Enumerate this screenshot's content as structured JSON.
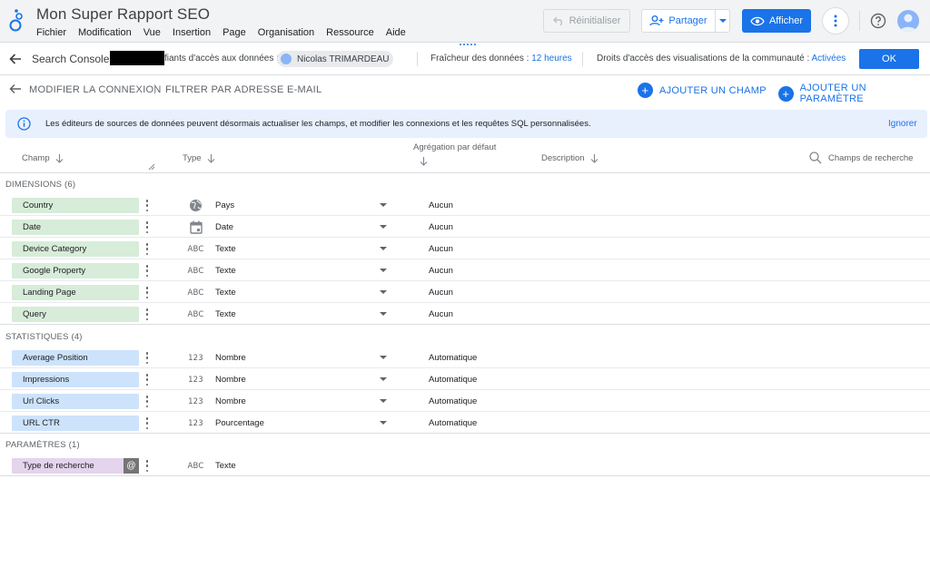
{
  "app": {
    "title": "Mon Super Rapport SEO",
    "menu": [
      "Fichier",
      "Modification",
      "Vue",
      "Insertion",
      "Page",
      "Organisation",
      "Ressource",
      "Aide"
    ],
    "reset_label": "Réinitialiser",
    "share_label": "Partager",
    "view_label": "Afficher"
  },
  "datasource": {
    "name": "Search Console",
    "credentials_label": "fiants d'accès aux données :",
    "owner": "Nicolas TRIMARDEAU",
    "freshness_label": "Fraîcheur des données :",
    "freshness_value": "12 heures",
    "rights_label": "Droits d'accès des visualisations de la communauté :",
    "rights_value": "Activées",
    "ok_label": "OK"
  },
  "toolbar": {
    "edit_connection": "MODIFIER LA CONNEXION",
    "pipe": "|",
    "filter_email": "FILTRER PAR ADRESSE E-MAIL",
    "add_field": "AJOUTER UN CHAMP",
    "add_param": "AJOUTER UN PARAMÈTRE"
  },
  "banner": {
    "message": "Les éditeurs de sources de données peuvent désormais actualiser les champs, et modifier les connexions et les requêtes SQL personnalisées.",
    "ignore": "Ignorer"
  },
  "table_header": {
    "field": "Champ",
    "type": "Type",
    "aggregation": "Agrégation par défaut",
    "description": "Description",
    "search_placeholder": "Champs de recherche"
  },
  "sections": {
    "dimensions": {
      "title": "DIMENSIONS (6)",
      "rows": [
        {
          "name": "Country",
          "type_icon": "globe-icon",
          "type": "Pays",
          "agg": "Aucun"
        },
        {
          "name": "Date",
          "type_icon": "calendar-icon",
          "type": "Date",
          "agg": "Aucun"
        },
        {
          "name": "Device Category",
          "type_icon": "abc-icon",
          "type": "Texte",
          "agg": "Aucun"
        },
        {
          "name": "Google Property",
          "type_icon": "abc-icon",
          "type": "Texte",
          "agg": "Aucun"
        },
        {
          "name": "Landing Page",
          "type_icon": "abc-icon",
          "type": "Texte",
          "agg": "Aucun"
        },
        {
          "name": "Query",
          "type_icon": "abc-icon",
          "type": "Texte",
          "agg": "Aucun"
        }
      ]
    },
    "metrics": {
      "title": "STATISTIQUES (4)",
      "rows": [
        {
          "name": "Average Position",
          "type_icon": "number-icon",
          "type": "Nombre",
          "agg": "Automatique"
        },
        {
          "name": "Impressions",
          "type_icon": "number-icon",
          "type": "Nombre",
          "agg": "Automatique"
        },
        {
          "name": "Url Clicks",
          "type_icon": "number-icon",
          "type": "Nombre",
          "agg": "Automatique"
        },
        {
          "name": "URL CTR",
          "type_icon": "number-icon",
          "type": "Pourcentage",
          "agg": "Automatique"
        }
      ]
    },
    "parameters": {
      "title": "PARAMÈTRES (1)",
      "rows": [
        {
          "name": "Type de recherche",
          "type_icon": "abc-icon",
          "type": "Texte",
          "badge": "@"
        }
      ]
    }
  },
  "glyphs": {
    "abc": "ABC",
    "number": "123",
    "plus": "+"
  },
  "colors": {
    "accent": "#1a73e8",
    "dimension_chip": "#d7ecd9",
    "metric_chip": "#cde3fb",
    "parameter_chip": "#e4d4ec",
    "banner_bg": "#e8f0fe"
  }
}
